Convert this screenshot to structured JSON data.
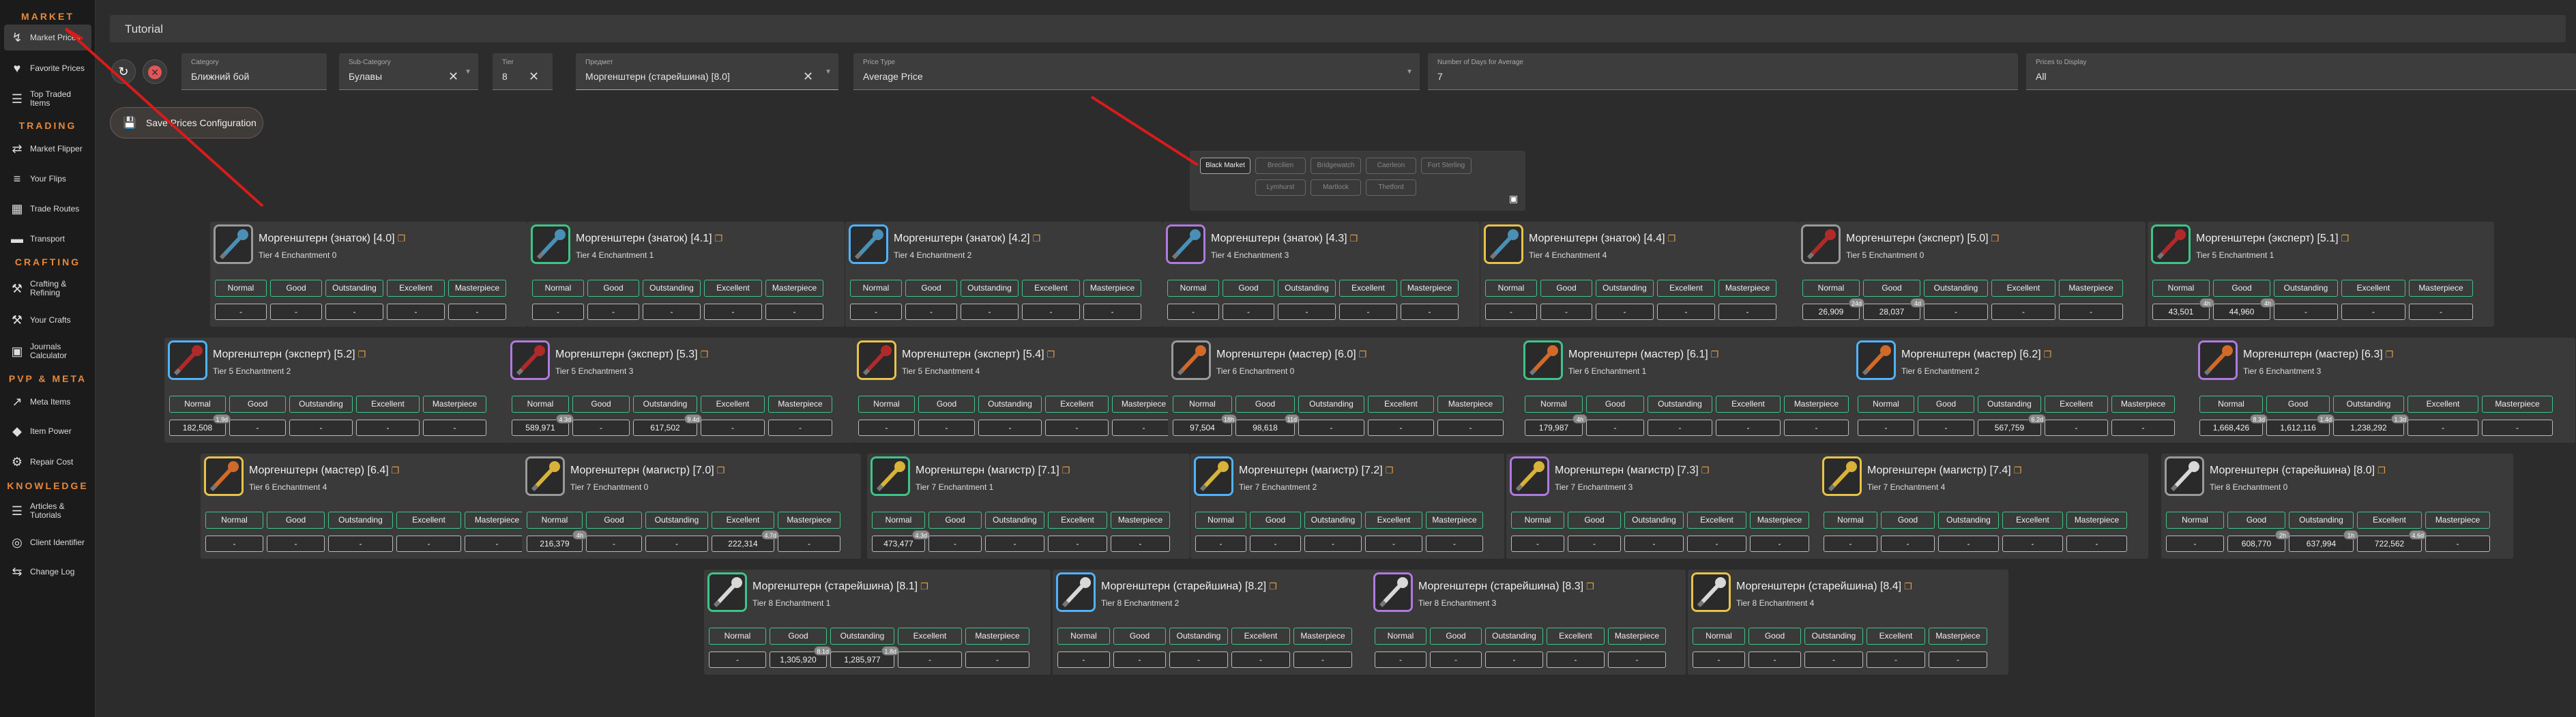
{
  "sidebar": {
    "sections": {
      "market": "MARKET",
      "trading": "TRADING",
      "crafting": "CRAFTING",
      "pvp_meta": "PVP & META",
      "knowledge": "KNOWLEDGE"
    },
    "items": [
      {
        "label": "Market Prices",
        "icon": "chart-icon",
        "active": true
      },
      {
        "label": "Favorite Prices",
        "icon": "heart-icon"
      },
      {
        "label": "Top Traded Items",
        "icon": "list-icon"
      },
      {
        "label": "Market Flipper",
        "icon": "flipper-icon"
      },
      {
        "label": "Your Flips",
        "icon": "flips-icon"
      },
      {
        "label": "Trade Routes",
        "icon": "routes-icon"
      },
      {
        "label": "Transport",
        "icon": "truck-icon"
      },
      {
        "label": "Crafting & Refining",
        "icon": "hammer-icon"
      },
      {
        "label": "Your Crafts",
        "icon": "crafts-icon"
      },
      {
        "label": "Journals Calculator",
        "icon": "calculator-icon"
      },
      {
        "label": "Meta Items",
        "icon": "trend-icon"
      },
      {
        "label": "Item Power",
        "icon": "shield-icon"
      },
      {
        "label": "Repair Cost",
        "icon": "wrench-icon"
      },
      {
        "label": "Articles & Tutorials",
        "icon": "book-icon"
      },
      {
        "label": "Client Identifier",
        "icon": "fingerprint-icon"
      },
      {
        "label": "Change Log",
        "icon": "swap-icon"
      }
    ]
  },
  "header": {
    "title": "Tutorial"
  },
  "filters": {
    "category": {
      "label": "Category",
      "value": "Ближний бой"
    },
    "subcategory": {
      "label": "Sub-Category",
      "value": "Булавы"
    },
    "tier": {
      "label": "Tier",
      "value": "8"
    },
    "item": {
      "label": "Предмет",
      "value": "Моргенштерн (старейшина) [8.0]"
    },
    "price_type": {
      "label": "Price Type",
      "value": "Average Price"
    },
    "days": {
      "label": "Number of Days for Average",
      "value": "7"
    },
    "display": {
      "label": "Prices to Display",
      "value": "All"
    }
  },
  "save_label": "Save Prices Configuration",
  "locations": [
    "Black Market",
    "Brecilien",
    "Bridgewatch",
    "Caerleon",
    "Fort Sterling",
    "Lymhurst",
    "Martlock",
    "Thetford"
  ],
  "selected_location": "Black Market",
  "qualities": [
    "Normal",
    "Good",
    "Outstanding",
    "Excellent",
    "Masterpiece"
  ],
  "colors": {
    "quality_border": "#3ec489",
    "accent": "#e8883a",
    "annotation": "#d81b1b"
  },
  "cards": [
    {
      "name": "Моргенштерн (знаток) [4.0]",
      "sub": "Tier 4 Enchantment 0",
      "prices": [
        "-",
        "-",
        "-",
        "-",
        "-"
      ],
      "badges": []
    },
    {
      "name": "Моргенштерн (знаток) [4.1]",
      "sub": "Tier 4 Enchantment 1",
      "prices": [
        "-",
        "-",
        "-",
        "-",
        "-"
      ],
      "badges": []
    },
    {
      "name": "Моргенштерн (знаток) [4.2]",
      "sub": "Tier 4 Enchantment 2",
      "prices": [
        "-",
        "-",
        "-",
        "-",
        "-"
      ],
      "badges": []
    },
    {
      "name": "Моргенштерн (знаток) [4.3]",
      "sub": "Tier 4 Enchantment 3",
      "prices": [
        "-",
        "-",
        "-",
        "-",
        "-"
      ],
      "badges": []
    },
    {
      "name": "Моргенштерн (знаток) [4.4]",
      "sub": "Tier 4 Enchantment 4",
      "prices": [
        "-",
        "-",
        "-",
        "-",
        "-"
      ],
      "badges": []
    },
    {
      "name": "Моргенштерн (эксперт) [5.0]",
      "sub": "Tier 5 Enchantment 0",
      "prices": [
        "26,909",
        "28,037",
        "-",
        "-",
        "-"
      ],
      "badges": [
        "24d",
        "4d",
        "",
        "",
        ""
      ]
    },
    {
      "name": "Моргенштерн (эксперт) [5.1]",
      "sub": "Tier 5 Enchantment 1",
      "prices": [
        "43,501",
        "44,960",
        "-",
        "-",
        "-"
      ],
      "badges": [
        "4h",
        "4h",
        "",
        "",
        ""
      ]
    },
    {
      "name": "Моргенштерн (эксперт) [5.2]",
      "sub": "Tier 5 Enchantment 2",
      "prices": [
        "182,508",
        "-",
        "-",
        "-",
        "-"
      ],
      "badges": [
        "1.9d",
        "",
        "",
        "",
        ""
      ]
    },
    {
      "name": "Моргенштерн (эксперт) [5.3]",
      "sub": "Tier 5 Enchantment 3",
      "prices": [
        "589,971",
        "-",
        "617,502",
        "-",
        "-"
      ],
      "badges": [
        "4.3d",
        "",
        "9.4d",
        "",
        ""
      ]
    },
    {
      "name": "Моргенштерн (эксперт) [5.4]",
      "sub": "Tier 5 Enchantment 4",
      "prices": [
        "-",
        "-",
        "-",
        "-",
        "-"
      ],
      "badges": []
    },
    {
      "name": "Моргенштерн (мастер) [6.0]",
      "sub": "Tier 6 Enchantment 0",
      "prices": [
        "97,504",
        "98,618",
        "-",
        "-",
        "-"
      ],
      "badges": [
        "18h",
        "11d",
        "",
        "",
        ""
      ]
    },
    {
      "name": "Моргенштерн (мастер) [6.1]",
      "sub": "Tier 6 Enchantment 1",
      "prices": [
        "179,987",
        "-",
        "-",
        "-",
        "-"
      ],
      "badges": [
        "4h",
        "",
        "",
        "",
        ""
      ]
    },
    {
      "name": "Моргенштерн (мастер) [6.2]",
      "sub": "Tier 6 Enchantment 2",
      "prices": [
        "-",
        "-",
        "567,759",
        "-",
        "-"
      ],
      "badges": [
        "",
        "",
        "6.2d",
        "",
        ""
      ]
    },
    {
      "name": "Моргенштерн (мастер) [6.3]",
      "sub": "Tier 6 Enchantment 3",
      "prices": [
        "1,668,426",
        "1,612,116",
        "1,238,292",
        "-",
        "-"
      ],
      "badges": [
        "8.3d",
        "1.4d",
        "1.3d",
        "",
        ""
      ]
    },
    {
      "name": "Моргенштерн (мастер) [6.4]",
      "sub": "Tier 6 Enchantment 4",
      "prices": [
        "-",
        "-",
        "-",
        "-",
        "-"
      ],
      "badges": []
    },
    {
      "name": "Моргенштерн (магистр) [7.0]",
      "sub": "Tier 7 Enchantment 0",
      "prices": [
        "216,379",
        "-",
        "-",
        "222,314",
        "-"
      ],
      "badges": [
        "4h",
        "",
        "",
        "4.7d",
        ""
      ]
    },
    {
      "name": "Моргенштерн (магистр) [7.1]",
      "sub": "Tier 7 Enchantment 1",
      "prices": [
        "473,477",
        "-",
        "-",
        "-",
        "-"
      ],
      "badges": [
        "4.3d",
        "",
        "",
        "",
        ""
      ]
    },
    {
      "name": "Моргенштерн (магистр) [7.2]",
      "sub": "Tier 7 Enchantment 2",
      "prices": [
        "-",
        "-",
        "-",
        "-",
        "-"
      ],
      "badges": []
    },
    {
      "name": "Моргенштерн (магистр) [7.3]",
      "sub": "Tier 7 Enchantment 3",
      "prices": [
        "-",
        "-",
        "-",
        "-",
        "-"
      ],
      "badges": []
    },
    {
      "name": "Моргенштерн (магистр) [7.4]",
      "sub": "Tier 7 Enchantment 4",
      "prices": [
        "-",
        "-",
        "-",
        "-",
        "-"
      ],
      "badges": []
    },
    {
      "name": "Моргенштерн (старейшина) [8.0]",
      "sub": "Tier 8 Enchantment 0",
      "prices": [
        "-",
        "608,770",
        "637,994",
        "722,562",
        "-"
      ],
      "badges": [
        "",
        "2h",
        "1h",
        "4.6d",
        ""
      ]
    },
    {
      "name": "Моргенштерн (старейшина) [8.1]",
      "sub": "Tier 8 Enchantment 1",
      "prices": [
        "-",
        "1,305,920",
        "1,285,977",
        "-",
        "-"
      ],
      "badges": [
        "",
        "8.1d",
        "1.8d",
        "",
        ""
      ]
    },
    {
      "name": "Моргенштерн (старейшина) [8.2]",
      "sub": "Tier 8 Enchantment 2",
      "prices": [
        "-",
        "-",
        "-",
        "-",
        "-"
      ],
      "badges": []
    },
    {
      "name": "Моргенштерн (старейшина) [8.3]",
      "sub": "Tier 8 Enchantment 3",
      "prices": [
        "-",
        "-",
        "-",
        "-",
        "-"
      ],
      "badges": []
    },
    {
      "name": "Моргенштерн (старейшина) [8.4]",
      "sub": "Tier 8 Enchantment 4",
      "prices": [
        "-",
        "-",
        "-",
        "-",
        "-"
      ],
      "badges": []
    }
  ]
}
